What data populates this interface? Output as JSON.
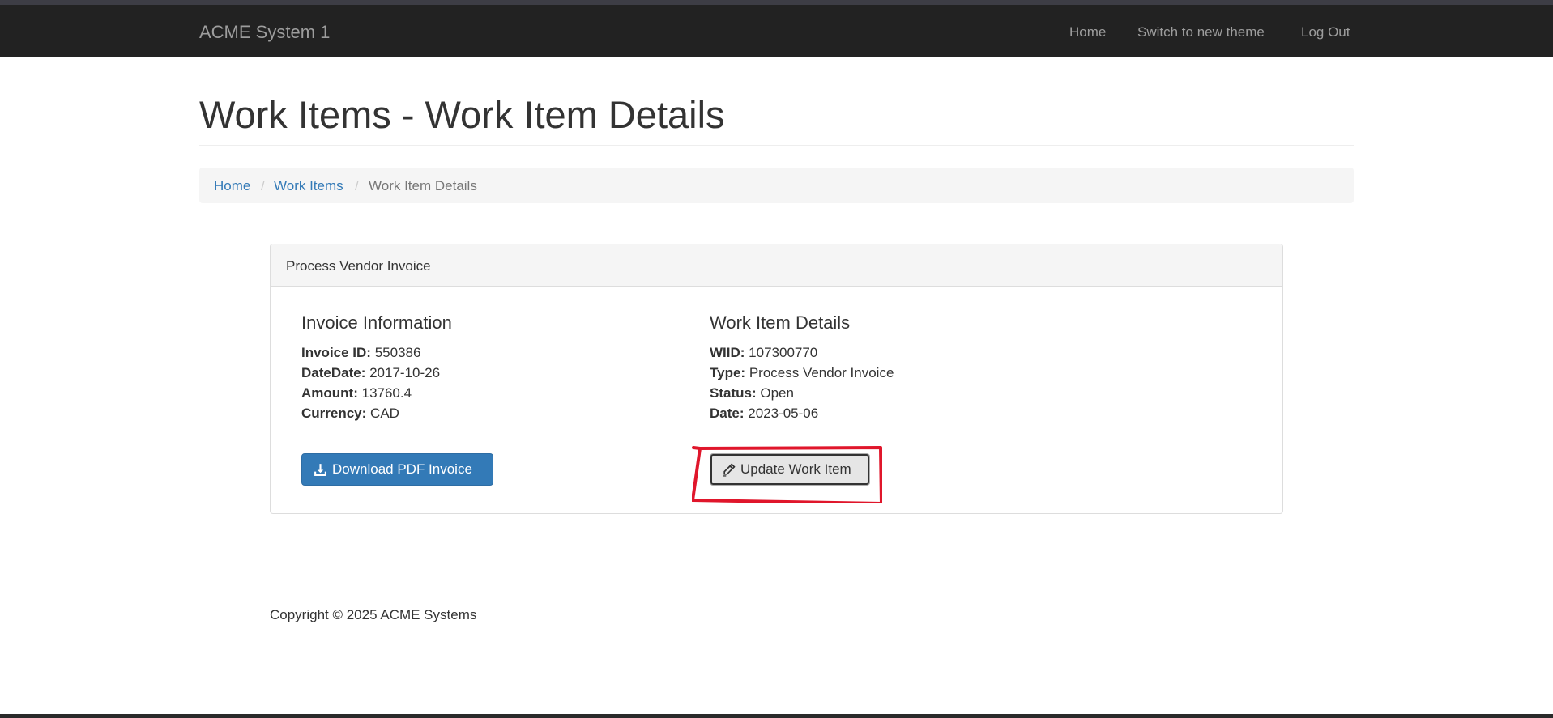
{
  "navbar": {
    "brand": "ACME System 1",
    "links": [
      "Home",
      "Switch to new theme",
      "Log Out"
    ]
  },
  "page": {
    "title": "Work Items - Work Item Details"
  },
  "breadcrumb": {
    "items": [
      "Home",
      "Work Items",
      "Work Item Details"
    ],
    "separator": "/"
  },
  "panel": {
    "heading": "Process Vendor Invoice",
    "invoice": {
      "title": "Invoice Information",
      "fields": [
        {
          "label": "Invoice ID:",
          "value": "550386"
        },
        {
          "label": "DateDate:",
          "value": "2017-10-26"
        },
        {
          "label": "Amount:",
          "value": "13760.4"
        },
        {
          "label": "Currency:",
          "value": "CAD"
        }
      ],
      "download_button": "Download PDF Invoice"
    },
    "work_item": {
      "title": "Work Item Details",
      "fields": [
        {
          "label": "WIID:",
          "value": "107300770"
        },
        {
          "label": "Type:",
          "value": "Process Vendor Invoice"
        },
        {
          "label": "Status:",
          "value": "Open"
        },
        {
          "label": "Date:",
          "value": "2023-05-06"
        }
      ],
      "update_button": "Update Work Item"
    }
  },
  "footer": {
    "copyright": "Copyright © 2025 ACME Systems"
  },
  "icons": {
    "download": "download-icon",
    "update": "pencil-icon"
  },
  "colors": {
    "navbar_bg": "#222222",
    "link": "#337ab7",
    "primary_button": "#337ab7",
    "annotation": "#e0162b"
  }
}
